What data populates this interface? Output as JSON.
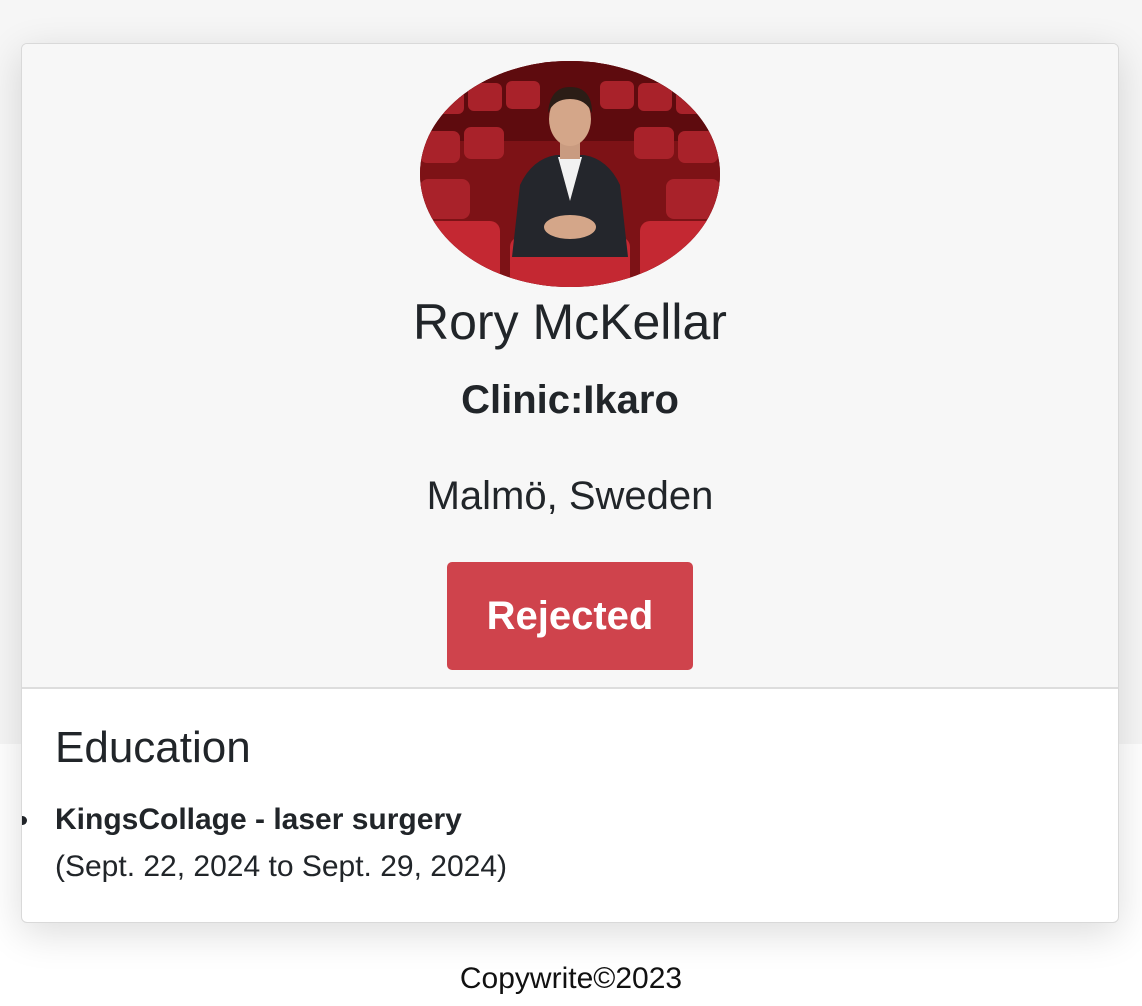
{
  "profile": {
    "name": "Rory McKellar",
    "clinic": "Clinic:Ikaro",
    "location": "Malmö, Sweden",
    "status": "Rejected",
    "status_color": "#cf434c"
  },
  "education": {
    "title": "Education",
    "items": [
      {
        "name": "KingsCollage - laser surgery",
        "dates": "(Sept. 22, 2024 to Sept. 29, 2024)"
      }
    ]
  },
  "footer": {
    "text": "Copywrite©2023"
  }
}
